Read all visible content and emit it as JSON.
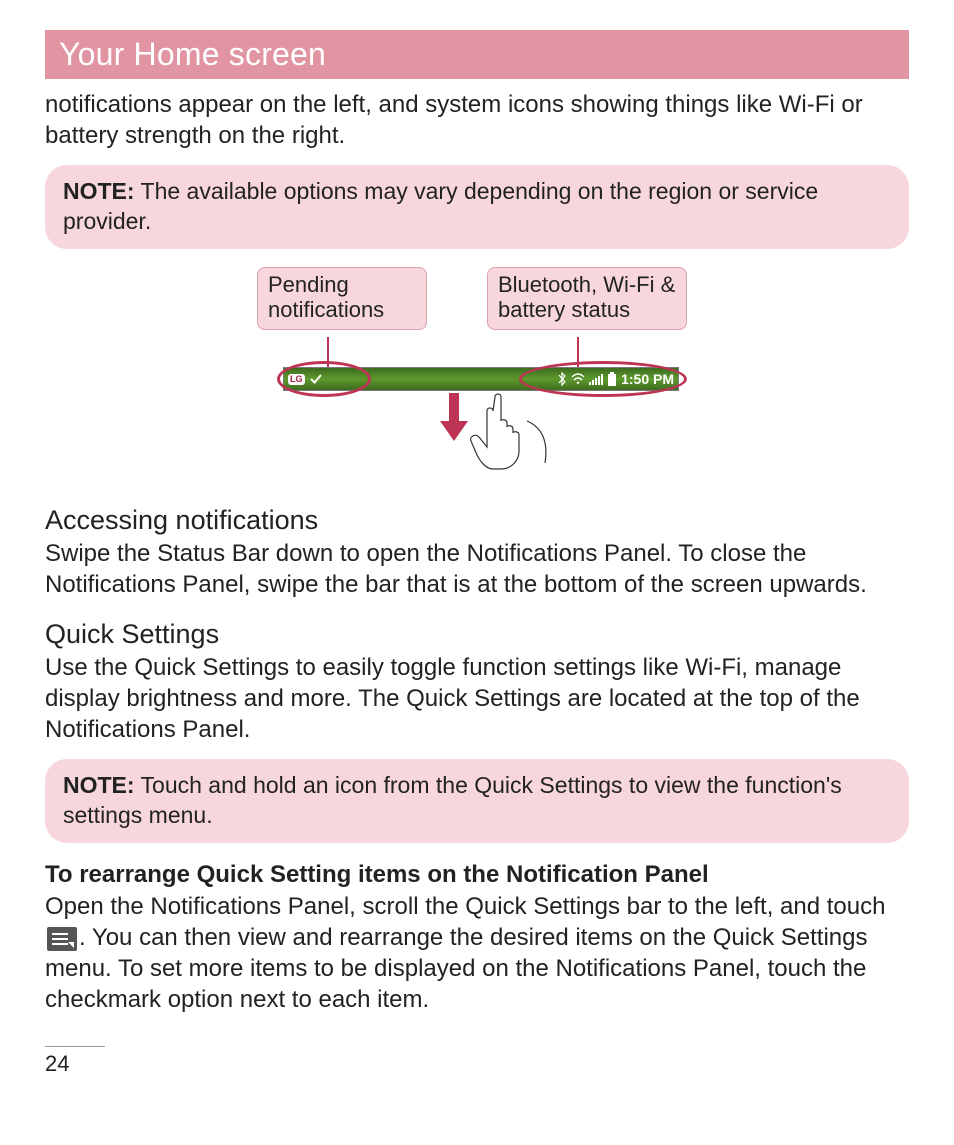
{
  "page": {
    "title": "Your Home screen",
    "number": "24"
  },
  "intro": "notifications appear on the left, and system icons showing things like Wi-Fi or battery strength on the right.",
  "note1": {
    "label": "NOTE:",
    "text": " The available options may vary depending on the region or service provider."
  },
  "illustration": {
    "callout_left": "Pending notifications",
    "callout_right": "Bluetooth, Wi-Fi & battery status",
    "status_time": "1:50 PM",
    "lg_badge": "LG"
  },
  "sections": {
    "accessing": {
      "heading": "Accessing notifications",
      "body": "Swipe the Status Bar down to open the Notifications Panel. To close the Notifications Panel, swipe the bar that is at the bottom of the screen upwards."
    },
    "quick": {
      "heading": "Quick Settings",
      "body": "Use the Quick Settings to easily toggle function settings like Wi-Fi, manage display brightness and more. The Quick Settings are located at the top of the Notifications Panel."
    }
  },
  "note2": {
    "label": "NOTE:",
    "text": " Touch and hold an icon from the Quick Settings to view the function's settings menu."
  },
  "rearrange": {
    "heading": "To rearrange Quick Setting items on the Notification Panel",
    "body_pre": "Open the Notifications Panel, scroll the Quick Settings bar to the left, and touch ",
    "body_post": ". You can then view and rearrange the desired items on the Quick Settings menu. To set more items to be displayed on the Notifications Panel, touch the checkmark option next to each item."
  }
}
